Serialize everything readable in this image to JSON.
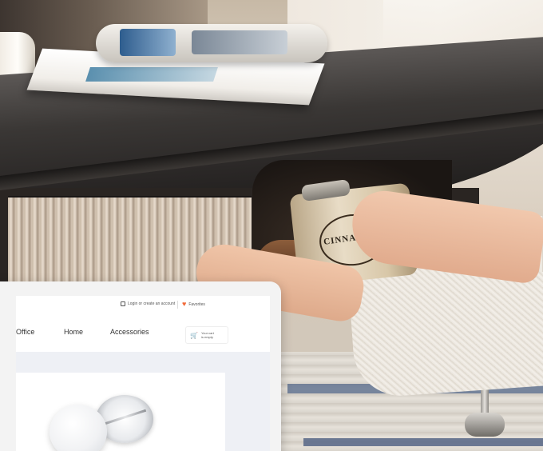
{
  "photo": {
    "tin_label": "CINNAMON"
  },
  "website": {
    "topbar": {
      "login_label": "Login or create an account",
      "favorites_label": "Favorites"
    },
    "nav": {
      "items": [
        "Office",
        "Home",
        "Accessories"
      ]
    },
    "cart": {
      "label_line1": "Your cart",
      "label_line2": "is empty"
    },
    "product": {
      "image_name": "pin-badge"
    },
    "colors": {
      "accent": "#f26a3a",
      "product_bg": "#eef0f5"
    }
  }
}
